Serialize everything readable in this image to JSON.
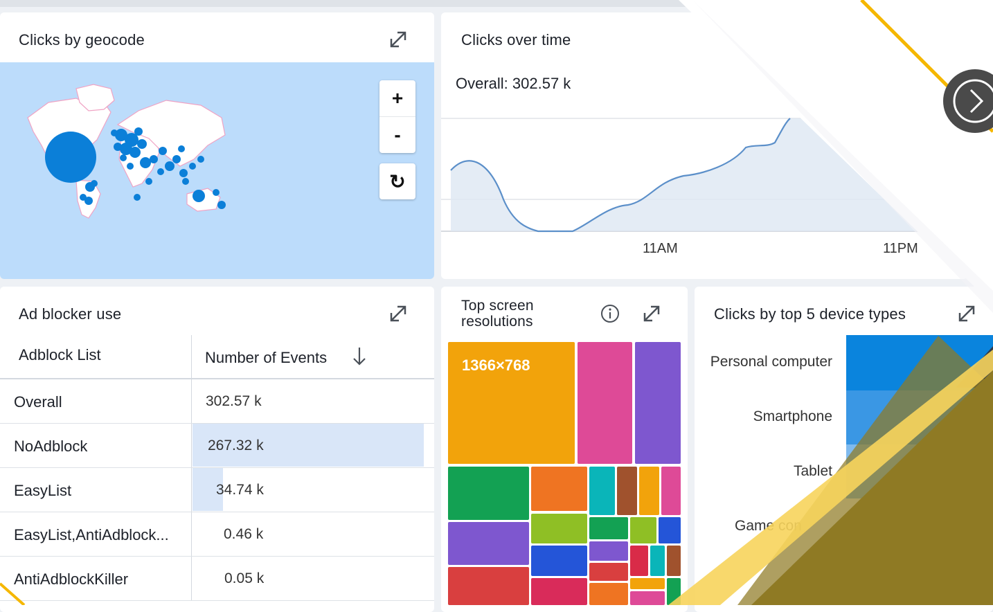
{
  "map_panel": {
    "title": "Clicks by geocode",
    "zoom_in": "+",
    "zoom_out": "-",
    "reset": "↻"
  },
  "time_panel": {
    "title": "Clicks over time",
    "overall": "Overall: 302.57 k",
    "x_ticks": [
      "11AM",
      "11PM"
    ]
  },
  "adblock_panel": {
    "title": "Ad blocker use",
    "col_list": "Adblock List",
    "col_events": "Number of Events",
    "rows": [
      {
        "name": "Overall",
        "value": "302.57 k",
        "share": 0
      },
      {
        "name": "NoAdblock",
        "value": "267.32 k",
        "share": 0.883
      },
      {
        "name": "EasyList",
        "value": "34.74 k",
        "share": 0.115
      },
      {
        "name": "EasyList,AntiAdblock...",
        "value": "0.46 k",
        "share": 0
      },
      {
        "name": "AntiAdblockKiller",
        "value": "0.05 k",
        "share": 0
      }
    ]
  },
  "treemap_panel": {
    "title_line1": "Top screen",
    "title_line2": "resolutions",
    "top_label": "1366×768"
  },
  "device_panel": {
    "title": "Clicks by top 5 device types",
    "devices": [
      "Personal computer",
      "Smartphone",
      "Tablet",
      "Game con"
    ]
  },
  "colors": {
    "map_water": "#bcdcfb",
    "map_dot": "#0b7fd8",
    "line": "#5b8fc9",
    "accent_yellow": "#f5b700",
    "olive": "#8f7a24"
  }
}
